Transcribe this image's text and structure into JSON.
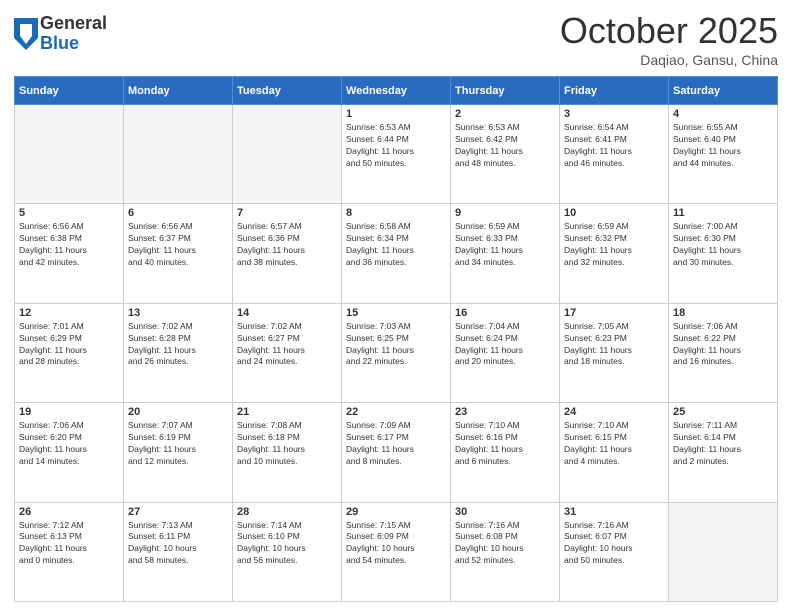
{
  "logo": {
    "general": "General",
    "blue": "Blue"
  },
  "header": {
    "month": "October 2025",
    "location": "Daqiao, Gansu, China"
  },
  "weekdays": [
    "Sunday",
    "Monday",
    "Tuesday",
    "Wednesday",
    "Thursday",
    "Friday",
    "Saturday"
  ],
  "weeks": [
    [
      {
        "day": "",
        "info": ""
      },
      {
        "day": "",
        "info": ""
      },
      {
        "day": "",
        "info": ""
      },
      {
        "day": "1",
        "info": "Sunrise: 6:53 AM\nSunset: 6:44 PM\nDaylight: 11 hours\nand 50 minutes."
      },
      {
        "day": "2",
        "info": "Sunrise: 6:53 AM\nSunset: 6:42 PM\nDaylight: 11 hours\nand 48 minutes."
      },
      {
        "day": "3",
        "info": "Sunrise: 6:54 AM\nSunset: 6:41 PM\nDaylight: 11 hours\nand 46 minutes."
      },
      {
        "day": "4",
        "info": "Sunrise: 6:55 AM\nSunset: 6:40 PM\nDaylight: 11 hours\nand 44 minutes."
      }
    ],
    [
      {
        "day": "5",
        "info": "Sunrise: 6:56 AM\nSunset: 6:38 PM\nDaylight: 11 hours\nand 42 minutes."
      },
      {
        "day": "6",
        "info": "Sunrise: 6:56 AM\nSunset: 6:37 PM\nDaylight: 11 hours\nand 40 minutes."
      },
      {
        "day": "7",
        "info": "Sunrise: 6:57 AM\nSunset: 6:36 PM\nDaylight: 11 hours\nand 38 minutes."
      },
      {
        "day": "8",
        "info": "Sunrise: 6:58 AM\nSunset: 6:34 PM\nDaylight: 11 hours\nand 36 minutes."
      },
      {
        "day": "9",
        "info": "Sunrise: 6:59 AM\nSunset: 6:33 PM\nDaylight: 11 hours\nand 34 minutes."
      },
      {
        "day": "10",
        "info": "Sunrise: 6:59 AM\nSunset: 6:32 PM\nDaylight: 11 hours\nand 32 minutes."
      },
      {
        "day": "11",
        "info": "Sunrise: 7:00 AM\nSunset: 6:30 PM\nDaylight: 11 hours\nand 30 minutes."
      }
    ],
    [
      {
        "day": "12",
        "info": "Sunrise: 7:01 AM\nSunset: 6:29 PM\nDaylight: 11 hours\nand 28 minutes."
      },
      {
        "day": "13",
        "info": "Sunrise: 7:02 AM\nSunset: 6:28 PM\nDaylight: 11 hours\nand 26 minutes."
      },
      {
        "day": "14",
        "info": "Sunrise: 7:02 AM\nSunset: 6:27 PM\nDaylight: 11 hours\nand 24 minutes."
      },
      {
        "day": "15",
        "info": "Sunrise: 7:03 AM\nSunset: 6:25 PM\nDaylight: 11 hours\nand 22 minutes."
      },
      {
        "day": "16",
        "info": "Sunrise: 7:04 AM\nSunset: 6:24 PM\nDaylight: 11 hours\nand 20 minutes."
      },
      {
        "day": "17",
        "info": "Sunrise: 7:05 AM\nSunset: 6:23 PM\nDaylight: 11 hours\nand 18 minutes."
      },
      {
        "day": "18",
        "info": "Sunrise: 7:06 AM\nSunset: 6:22 PM\nDaylight: 11 hours\nand 16 minutes."
      }
    ],
    [
      {
        "day": "19",
        "info": "Sunrise: 7:06 AM\nSunset: 6:20 PM\nDaylight: 11 hours\nand 14 minutes."
      },
      {
        "day": "20",
        "info": "Sunrise: 7:07 AM\nSunset: 6:19 PM\nDaylight: 11 hours\nand 12 minutes."
      },
      {
        "day": "21",
        "info": "Sunrise: 7:08 AM\nSunset: 6:18 PM\nDaylight: 11 hours\nand 10 minutes."
      },
      {
        "day": "22",
        "info": "Sunrise: 7:09 AM\nSunset: 6:17 PM\nDaylight: 11 hours\nand 8 minutes."
      },
      {
        "day": "23",
        "info": "Sunrise: 7:10 AM\nSunset: 6:16 PM\nDaylight: 11 hours\nand 6 minutes."
      },
      {
        "day": "24",
        "info": "Sunrise: 7:10 AM\nSunset: 6:15 PM\nDaylight: 11 hours\nand 4 minutes."
      },
      {
        "day": "25",
        "info": "Sunrise: 7:11 AM\nSunset: 6:14 PM\nDaylight: 11 hours\nand 2 minutes."
      }
    ],
    [
      {
        "day": "26",
        "info": "Sunrise: 7:12 AM\nSunset: 6:13 PM\nDaylight: 11 hours\nand 0 minutes."
      },
      {
        "day": "27",
        "info": "Sunrise: 7:13 AM\nSunset: 6:11 PM\nDaylight: 10 hours\nand 58 minutes."
      },
      {
        "day": "28",
        "info": "Sunrise: 7:14 AM\nSunset: 6:10 PM\nDaylight: 10 hours\nand 56 minutes."
      },
      {
        "day": "29",
        "info": "Sunrise: 7:15 AM\nSunset: 6:09 PM\nDaylight: 10 hours\nand 54 minutes."
      },
      {
        "day": "30",
        "info": "Sunrise: 7:16 AM\nSunset: 6:08 PM\nDaylight: 10 hours\nand 52 minutes."
      },
      {
        "day": "31",
        "info": "Sunrise: 7:16 AM\nSunset: 6:07 PM\nDaylight: 10 hours\nand 50 minutes."
      },
      {
        "day": "",
        "info": ""
      }
    ]
  ]
}
